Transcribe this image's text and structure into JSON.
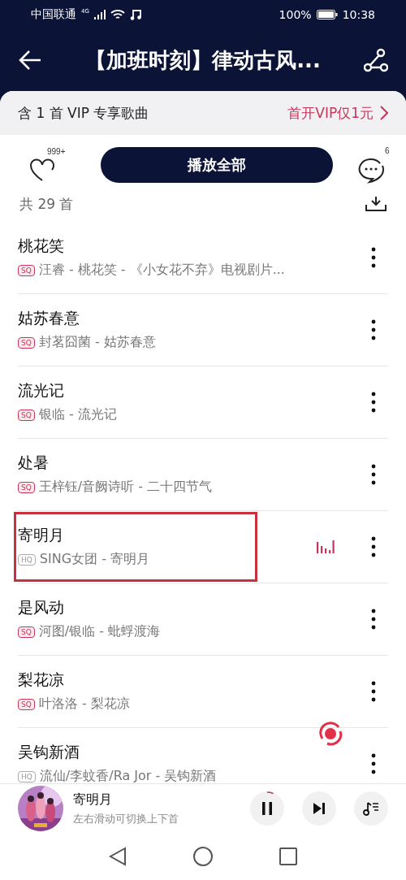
{
  "status_bar": {
    "carrier": "中国联通",
    "network": "4G",
    "battery": "100%",
    "time": "10:38"
  },
  "header": {
    "title": "【加班时刻】律动古风..."
  },
  "vip_banner": {
    "text": "含 1 首 VIP 专享歌曲",
    "link": "首开VIP仅1元"
  },
  "actions": {
    "favorite_count": "999+",
    "play_all": "播放全部",
    "comment_count": "6"
  },
  "song_count": "共 29 首",
  "songs": [
    {
      "title": "桃花笑",
      "quality": "SQ",
      "subtitle": "汪睿 - 桃花笑 - 《小女花不弃》电视剧片...",
      "playing": false,
      "highlighted": false
    },
    {
      "title": "姑苏春意",
      "quality": "SQ",
      "subtitle": "封茗囧菌 - 姑苏春意",
      "playing": false,
      "highlighted": false
    },
    {
      "title": "流光记",
      "quality": "SQ",
      "subtitle": "银临 - 流光记",
      "playing": false,
      "highlighted": false
    },
    {
      "title": "处暑",
      "quality": "SQ",
      "subtitle": "王梓钰/音阙诗听 - 二十四节气",
      "playing": false,
      "highlighted": false
    },
    {
      "title": "寄明月",
      "quality": "HQ",
      "subtitle": "SING女团 - 寄明月",
      "playing": true,
      "highlighted": true
    },
    {
      "title": "是风动",
      "quality": "SQ",
      "subtitle": "河图/银临 - 蚍蜉渡海",
      "playing": false,
      "highlighted": false
    },
    {
      "title": "梨花凉",
      "quality": "SQ",
      "subtitle": "叶洛洛 - 梨花凉",
      "playing": false,
      "highlighted": false
    },
    {
      "title": "吴钩新酒",
      "quality": "HQ",
      "subtitle": "流仙/李蚊香/Ra Jor - 吴钩新酒",
      "playing": false,
      "highlighted": false
    }
  ],
  "mini_player": {
    "title": "寄明月",
    "hint": "左右滑动可切换上下首",
    "level": 0.06
  }
}
